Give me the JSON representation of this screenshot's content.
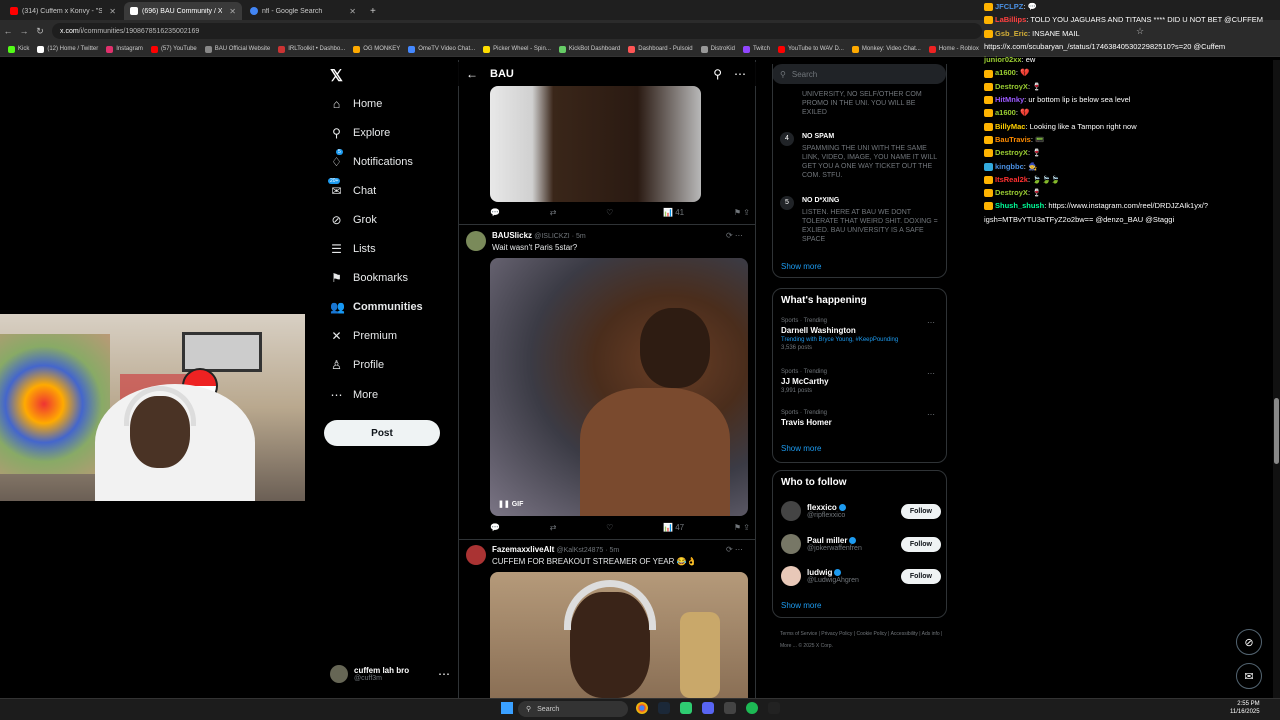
{
  "browser": {
    "tabs": [
      {
        "title": "(314) Cuffem x Konvy - \"Slow M",
        "color": "#ff0000",
        "active": false
      },
      {
        "title": "(696) BAU Community / X",
        "color": "#ffffff",
        "active": true
      },
      {
        "title": "nfl - Google Search",
        "color": "#4285f4",
        "active": false
      }
    ],
    "url_domain": "x.com",
    "url_path": "/i/communities/1908678516235002169",
    "bookmarks": [
      "Kick",
      "(12) Home / Twitter",
      "Instagram",
      "(57) YouTube",
      "BAU Official Website",
      "IRLToolkit • Dashbo...",
      "OG MONKEY",
      "OmeTV Video Chat...",
      "Picker Wheel - Spin...",
      "KickBot Dashboard",
      "Dashboard - Pulsoid",
      "DistroKid",
      "Twitch",
      "YouTube to WAV D...",
      "Monkey: Video Chat...",
      "Home - Roblox",
      "All Bookmarks"
    ]
  },
  "nav": {
    "items": [
      {
        "label": "Home",
        "icon": "home-icon"
      },
      {
        "label": "Explore",
        "icon": "search-icon"
      },
      {
        "label": "Notifications",
        "icon": "bell-icon",
        "badge": "5"
      },
      {
        "label": "Chat",
        "icon": "chat-icon",
        "badge": "20+"
      },
      {
        "label": "Grok",
        "icon": "grok-icon"
      },
      {
        "label": "Lists",
        "icon": "list-icon"
      },
      {
        "label": "Bookmarks",
        "icon": "bookmark-icon"
      },
      {
        "label": "Communities",
        "icon": "communities-icon",
        "bold": true
      },
      {
        "label": "Premium",
        "icon": "x-icon"
      },
      {
        "label": "Profile",
        "icon": "profile-icon"
      },
      {
        "label": "More",
        "icon": "more-icon"
      }
    ],
    "post_label": "Post",
    "account_name": "cuffem lah bro",
    "account_handle": "@cuff3m"
  },
  "community": {
    "title": "BAU",
    "tweets": [
      {
        "likes": "41"
      },
      {
        "name": "BAUSlickz",
        "handle": "@ISLICKZI · 5m",
        "text": "Wait wasn't Paris 5star?",
        "gif_label": "GIF",
        "likes": "47"
      },
      {
        "name": "FazemaxxliveAlt",
        "handle": "@KalKst24875 · 5m",
        "text": "CUFFEM FOR BREAKOUT STREAMER OF YEAR 😂👌"
      }
    ]
  },
  "sidebar": {
    "search_placeholder": "Search",
    "rules_top_fragment": "UNIVERSITY, NO SELF/OTHER COM PROMO IN THE UNI. YOU WILL BE EXILED",
    "rules": [
      {
        "num": "4",
        "title": "NO SPAM",
        "body": "SPAMMING THE UNI WITH THE SAME LINK, VIDEO, IMAGE, YOU NAME IT WILL GET YOU A ONE WAY TICKET OUT THE COM. STFU."
      },
      {
        "num": "5",
        "title": "NO D*XING",
        "body": "LISTEN. HERE AT BAU WE DONT TOLERATE THAT WEIRD SHIT. DOXING = EXLIED. BAU UNIVERSITY IS A SAFE SPACE"
      }
    ],
    "show_more": "Show more",
    "happening_title": "What's happening",
    "trends": [
      {
        "category": "Sports · Trending",
        "name": "Darnell Washington",
        "sub": "Trending with Bryce Young, #KeepPounding",
        "posts": "3,536 posts"
      },
      {
        "category": "Sports · Trending",
        "name": "JJ McCarthy",
        "posts": "3,991 posts"
      },
      {
        "category": "Sports · Trending",
        "name": "Travis Homer"
      }
    ],
    "follow_title": "Who to follow",
    "follows": [
      {
        "name": "flexxico",
        "handle": "@ripflexxico",
        "button": "Follow"
      },
      {
        "name": "Paul miller",
        "handle": "@jokerwaffenfren",
        "button": "Follow"
      },
      {
        "name": "ludwig",
        "handle": "@LudwigAhgren",
        "button": "Follow"
      }
    ],
    "footer": "Terms of Service | Privacy Policy | Cookie Policy | Accessibility | Ads info | More ... © 2025 X Corp."
  },
  "chat": [
    {
      "user": "JFCLPZ",
      "text": "💬",
      "color": "#4a90e2"
    },
    {
      "user": "LaBillips",
      "text": "TOLD YOU JAGUARS AND TITANS **** DID U NOT BET @CUFFEM",
      "color": "#ff4040"
    },
    {
      "user": "Gsb_Eric",
      "text": "INSANE MAIL",
      "color": "#d4af37"
    },
    {
      "user": "",
      "text": "https://x.com/scubaryan_/status/1746384053022982510?s=20 @Cuffem",
      "color": "#ffffff"
    },
    {
      "user": "junior02xx",
      "text": "ew",
      "color": "#9acd32"
    },
    {
      "user": "a1600",
      "text": "💔",
      "color": "#9acd32"
    },
    {
      "user": "DestroyX",
      "text": "🍷",
      "color": "#9acd32"
    },
    {
      "user": "HitMnky",
      "text": "ur bottom lip is below sea level",
      "color": "#9b59ff"
    },
    {
      "user": "a1600",
      "text": "💔",
      "color": "#9acd32"
    },
    {
      "user": "BillyMac",
      "text": "Looking like a Tampon right now",
      "color": "#ffd000"
    },
    {
      "user": "BauTravis",
      "text": "📟",
      "color": "#ff8c00"
    },
    {
      "user": "DestroyX",
      "text": "🍷",
      "color": "#9acd32"
    },
    {
      "user": "kingbbc",
      "text": "🧙",
      "color": "#4a90e2"
    },
    {
      "user": "ItsReal2k",
      "text": "🍃🍃🍃",
      "color": "#ff3030"
    },
    {
      "user": "DestroyX",
      "text": "🍷",
      "color": "#9acd32"
    },
    {
      "user": "Shush_shush",
      "text": "https://www.instagram.com/reel/DRDJZAIk1yx/?igsh=MTBvYTU3aTFyZ2o2bw== @denzo_BAU @Staggi",
      "color": "#00ff99"
    }
  ],
  "taskbar": {
    "search_label": "Search",
    "time": "2:55 PM",
    "date": "11/16/2025"
  }
}
